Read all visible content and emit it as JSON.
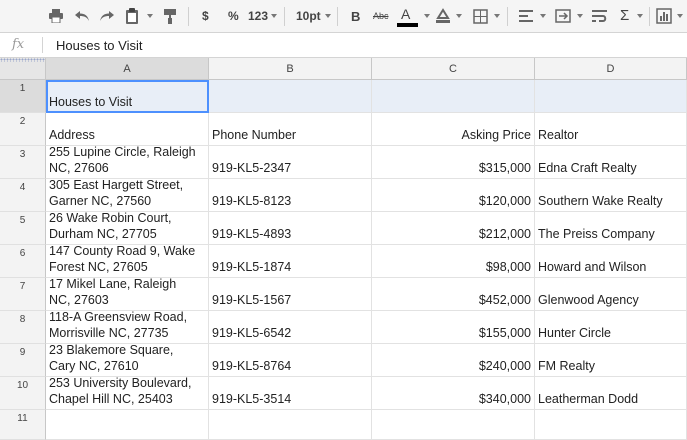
{
  "toolbar": {
    "icons": [
      "print-icon",
      "undo-icon",
      "redo-icon",
      "paint-format-icon",
      "clipboard-icon"
    ],
    "currency_label": "$",
    "percent_label": "%",
    "number_format_label": "123",
    "font_size": "10pt",
    "bold_label": "B",
    "strikethrough_label": "Abc",
    "text_color_label": "A",
    "fill_color_label": "A",
    "sum_label": "Σ",
    "accent_color": "#4d90fe",
    "text_color_bar": "#000000"
  },
  "formula_bar": {
    "fx_label": "fx",
    "value": "Houses to Visit"
  },
  "sheet": {
    "columns": [
      "A",
      "B",
      "C",
      "D"
    ],
    "rows": [
      {
        "num": "1",
        "cells": [
          "Houses to Visit",
          "",
          "",
          ""
        ]
      },
      {
        "num": "2",
        "cells": [
          "Address",
          "Phone Number",
          "Asking Price",
          "Realtor"
        ]
      },
      {
        "num": "3",
        "cells": [
          "255 Lupine Circle, Raleigh\nNC, 27606",
          "919-KL5-2347",
          "$315,000",
          "Edna Craft Realty"
        ]
      },
      {
        "num": "4",
        "cells": [
          "305 East Hargett Street,\nGarner NC, 27560",
          "919-KL5-8123",
          "$120,000",
          "Southern Wake Realty"
        ]
      },
      {
        "num": "5",
        "cells": [
          "26 Wake Robin Court,\nDurham NC, 27705",
          "919-KL5-4893",
          "$212,000",
          "The Preiss Company"
        ]
      },
      {
        "num": "6",
        "cells": [
          "147 County Road 9, Wake\nForest NC, 27605",
          "919-KL5-1874",
          "$98,000",
          "Howard and Wilson"
        ]
      },
      {
        "num": "7",
        "cells": [
          "17 Mikel Lane, Raleigh\nNC, 27603",
          "919-KL5-1567",
          "$452,000",
          "Glenwood Agency"
        ]
      },
      {
        "num": "8",
        "cells": [
          "118-A Greensview Road,\nMorrisville NC, 27735",
          "919-KL5-6542",
          "$155,000",
          "Hunter Circle"
        ]
      },
      {
        "num": "9",
        "cells": [
          "23 Blakemore Square,\nCary NC, 27610",
          "919-KL5-8764",
          "$240,000",
          "FM Realty"
        ]
      },
      {
        "num": "10",
        "cells": [
          "253 University Boulevard,\nChapel Hill NC, 25403",
          "919-KL5-3514",
          "$340,000",
          "Leatherman Dodd"
        ]
      },
      {
        "num": "11",
        "cells": [
          "",
          "",
          "",
          ""
        ]
      }
    ]
  }
}
